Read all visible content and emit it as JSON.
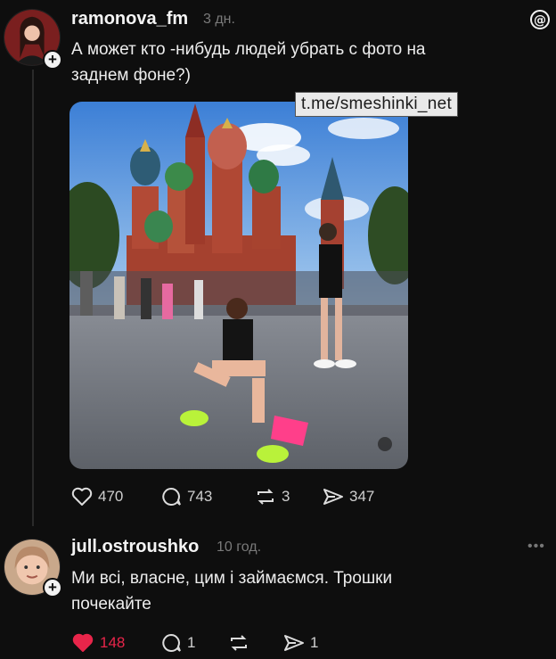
{
  "post": {
    "username": "ramonova_fm",
    "time": "3 дн.",
    "text_line1": "А может кто -нибудь людей убрать с фото на",
    "text_line2": "заднем фоне?)",
    "watermark": "t.me/smeshinki_net",
    "likes": "470",
    "replies": "743",
    "reposts": "3",
    "shares": "347"
  },
  "reply": {
    "username": "jull.ostroushko",
    "time": "10 год.",
    "text_line1": "Ми всі, власне, цим і займаємся. Трошки",
    "text_line2": "почекайте",
    "likes": "148",
    "replies": "1",
    "reposts": "",
    "shares": "1"
  },
  "colors": {
    "background": "#0e0e0e",
    "liked_heart": "#e8254a",
    "muted_text": "#7a7a7a"
  },
  "icons": [
    "threads-logo-icon",
    "heart-icon",
    "comment-icon",
    "repost-icon",
    "share-icon",
    "plus-icon",
    "more-icon"
  ]
}
